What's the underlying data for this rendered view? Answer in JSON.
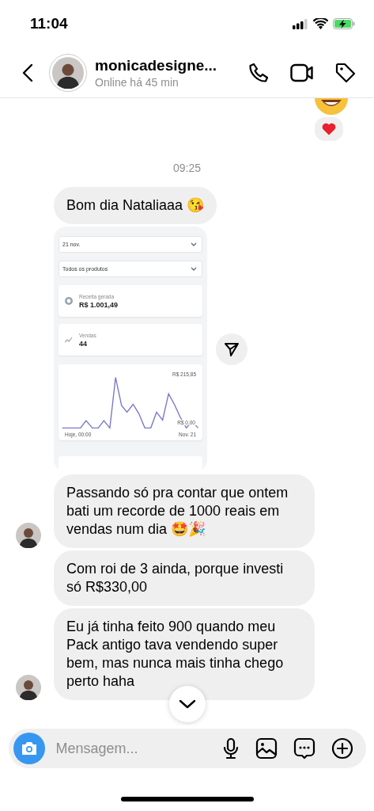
{
  "status_bar": {
    "time": "11:04"
  },
  "header": {
    "name": "monicadesigne...",
    "status": "Online há 45 min"
  },
  "reaction": {
    "kind": "heart"
  },
  "timestamp": "09:25",
  "messages": [
    {
      "kind": "text",
      "text": "Bom dia Nataliaaa 😘",
      "avatar": false
    },
    {
      "kind": "dashboard",
      "avatar": false,
      "date_select": "21 nov.",
      "product_select": "Todos os produtos",
      "stats": [
        {
          "kind": "coin",
          "label": "Receita gerada",
          "value": "R$ 1.001,49"
        },
        {
          "kind": "trend",
          "label": "Vendas",
          "value": "44"
        }
      ],
      "chart": {
        "max_label": "R$ 215,85",
        "min_label": "R$ 0,00",
        "start_label": "Hoje, 00:00",
        "end_label": "Nov. 21"
      }
    },
    {
      "kind": "text",
      "text": "Passando só pra contar que ontem bati um recorde de 1000 reais em vendas num dia 🤩🎉",
      "avatar": true
    },
    {
      "kind": "text",
      "text": "Com roi de 3 ainda, porque investi só R$330,00",
      "avatar": false
    },
    {
      "kind": "text",
      "text": "Eu já tinha feito 900 quando meu Pack antigo tava vendendo super bem, mas nunca mais tinha chego perto haha",
      "avatar": true
    }
  ],
  "composer": {
    "placeholder": "Mensagem..."
  }
}
